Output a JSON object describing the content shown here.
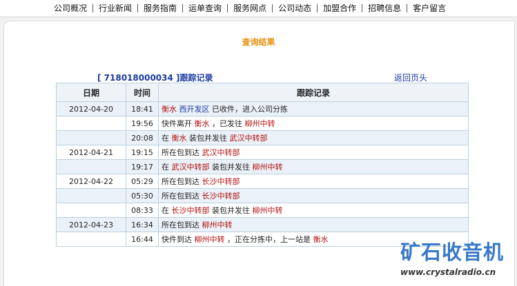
{
  "nav": [
    "公司概况",
    "行业新闻",
    "服务指南",
    "运单查询",
    "服务网点",
    "公司动态",
    "加盟合作",
    "招聘信息",
    "客户留言"
  ],
  "result_title": "查询结果",
  "tracking": {
    "number_text": "[ 718018000034 ]",
    "label": "跟踪记录",
    "back_link": "返回页头"
  },
  "table": {
    "headers": {
      "date": "日期",
      "time": "时间",
      "record": "跟踪记录"
    },
    "rows": [
      {
        "date": "2012-04-20",
        "time": "18:41",
        "segments": [
          {
            "t": "衡水",
            "red": true
          },
          {
            "t": " "
          },
          {
            "t": "西开发区",
            "blue": true
          },
          {
            "t": " 已收件，进入公司分拣"
          }
        ]
      },
      {
        "date": "",
        "time": "19:56",
        "segments": [
          {
            "t": "快件离开 "
          },
          {
            "t": "衡水",
            "red": true
          },
          {
            "t": " ，已发往 "
          },
          {
            "t": "柳州中转",
            "red": true
          }
        ]
      },
      {
        "date": "",
        "time": "20:08",
        "segments": [
          {
            "t": "在 "
          },
          {
            "t": "衡水",
            "red": true
          },
          {
            "t": " 装包并发往 "
          },
          {
            "t": "武汉中转部",
            "red": true
          }
        ]
      },
      {
        "date": "2012-04-21",
        "time": "19:15",
        "segments": [
          {
            "t": "所在包到达 "
          },
          {
            "t": "武汉中转部",
            "red": true
          }
        ]
      },
      {
        "date": "",
        "time": "19:17",
        "segments": [
          {
            "t": "在 "
          },
          {
            "t": "武汉中转部",
            "red": true
          },
          {
            "t": " 装包并发往 "
          },
          {
            "t": "柳州中转",
            "red": true
          }
        ]
      },
      {
        "date": "2012-04-22",
        "time": "05:29",
        "segments": [
          {
            "t": "所在包到达 "
          },
          {
            "t": "长沙中转部",
            "red": true
          }
        ]
      },
      {
        "date": "",
        "time": "05:30",
        "segments": [
          {
            "t": "所在包到达 "
          },
          {
            "t": "长沙中转部",
            "red": true
          }
        ]
      },
      {
        "date": "",
        "time": "08:33",
        "segments": [
          {
            "t": "在 "
          },
          {
            "t": "长沙中转部",
            "red": true
          },
          {
            "t": " 装包并发往 "
          },
          {
            "t": "柳州中转",
            "red": true
          }
        ]
      },
      {
        "date": "2012-04-23",
        "time": "16:34",
        "segments": [
          {
            "t": "所在包到达 "
          },
          {
            "t": "柳州中转",
            "red": true
          }
        ]
      },
      {
        "date": "",
        "time": "16:44",
        "segments": [
          {
            "t": "快件到达 "
          },
          {
            "t": "柳州中转",
            "red": true
          },
          {
            "t": " ，正在分拣中，上一站是 "
          },
          {
            "t": "衡水",
            "red": true
          }
        ]
      }
    ]
  },
  "watermark": {
    "title": "矿石收音机",
    "url": "www.crystalradio.cn"
  },
  "colors": {
    "accent_orange": "#e8900c",
    "link_blue": "#1a3aa0",
    "place_red": "#b31010",
    "row_alt": "#eaf1f8",
    "border": "#b9cfe0",
    "watermark_blue": "#3878c8"
  }
}
